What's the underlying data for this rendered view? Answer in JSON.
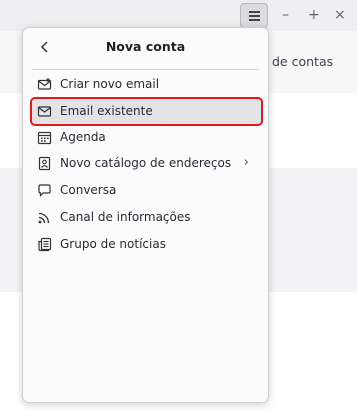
{
  "window": {
    "minimize_label": "–",
    "maximize_label": "+",
    "close_label": "×"
  },
  "background": {
    "link_text": "de contas"
  },
  "panel": {
    "back_label": "‹",
    "title": "Nova conta",
    "items": [
      {
        "label": "Criar novo email",
        "icon": "mail-icon",
        "has_submenu": false
      },
      {
        "label": "Email existente",
        "icon": "mail-icon",
        "has_submenu": false,
        "selected": true
      },
      {
        "label": "Agenda",
        "icon": "calendar-icon",
        "has_submenu": false
      },
      {
        "label": "Novo catálogo de endereços",
        "icon": "address-book-icon",
        "has_submenu": true
      },
      {
        "label": "Conversa",
        "icon": "chat-icon",
        "has_submenu": false
      },
      {
        "label": "Canal de informações",
        "icon": "rss-icon",
        "has_submenu": false
      },
      {
        "label": "Grupo de notícias",
        "icon": "newsgroup-icon",
        "has_submenu": false
      }
    ],
    "submenu_chevron": "›"
  },
  "colors": {
    "highlight_border": "#e01b1b",
    "selected_bg": "#e3e3e7",
    "panel_bg": "#fbfbfc"
  }
}
